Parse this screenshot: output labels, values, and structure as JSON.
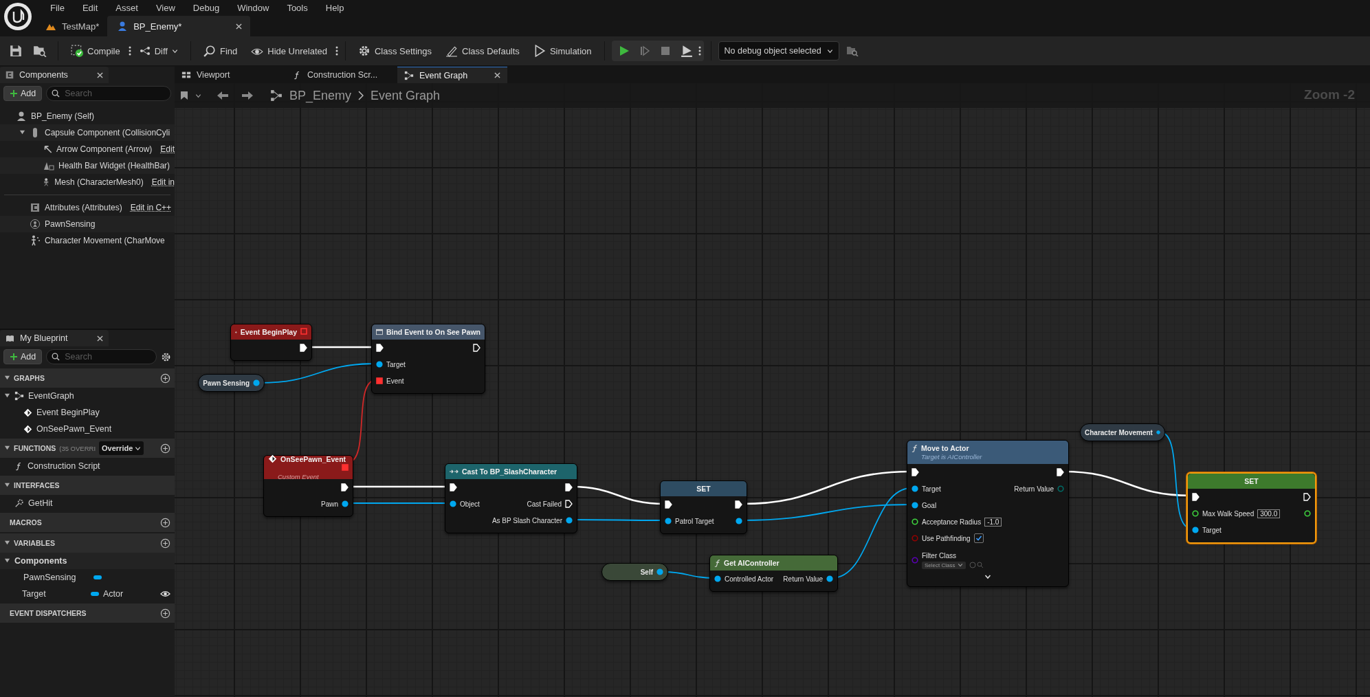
{
  "menu": [
    "File",
    "Edit",
    "Asset",
    "View",
    "Debug",
    "Window",
    "Tools",
    "Help"
  ],
  "doc_tabs": [
    {
      "label": "TestMap*",
      "kind": "map",
      "selected": false
    },
    {
      "label": "BP_Enemy*",
      "kind": "blueprint",
      "selected": true
    }
  ],
  "toolbar": [
    {
      "label": "Compile",
      "kind": "compile",
      "more": true
    },
    {
      "label": "Diff",
      "kind": "diff",
      "dropdown": true
    },
    {
      "label": "Find",
      "kind": "find"
    },
    {
      "label": "Hide Unrelated",
      "kind": "hide",
      "more": true
    },
    {
      "label": "Class Settings",
      "kind": "settings"
    },
    {
      "label": "Class Defaults",
      "kind": "defaults"
    },
    {
      "label": "Simulation",
      "kind": "simulation"
    }
  ],
  "debug_selector": {
    "value": "No debug object selected"
  },
  "components": {
    "title": "Components",
    "add_label": "Add",
    "search_placeholder": "Search",
    "tree": [
      {
        "label": "BP_Enemy (Self)",
        "kind": "self",
        "children": [
          {
            "label": "Capsule Component (CollisionCyli",
            "kind": "capsule",
            "expanded": true,
            "children": [
              {
                "label": "Arrow Component (Arrow)",
                "kind": "arrow",
                "link": "Edit"
              },
              {
                "label": "Health Bar Widget (HealthBar)",
                "kind": "widget"
              },
              {
                "label": "Mesh (CharacterMesh0)",
                "kind": "mesh",
                "link": "Edit in"
              }
            ]
          }
        ]
      }
    ],
    "other": [
      {
        "label": "Attributes (Attributes)",
        "kind": "attributes",
        "link": "Edit in C++"
      },
      {
        "label": "PawnSensing",
        "kind": "sensing"
      },
      {
        "label": "Character Movement (CharMove",
        "kind": "movement"
      }
    ]
  },
  "my_blueprint": {
    "title": "My Blueprint",
    "add_label": "Add",
    "search_placeholder": "Search",
    "sections": [
      {
        "title": "GRAPHS",
        "expanded": true,
        "addable": true,
        "items": [
          {
            "label": "EventGraph",
            "kind": "graph",
            "expanded": true,
            "children": [
              {
                "label": "Event BeginPlay",
                "kind": "event"
              },
              {
                "label": "OnSeePawn_Event",
                "kind": "event"
              }
            ]
          }
        ]
      },
      {
        "title": "FUNCTIONS",
        "note": "(35 OVERRI",
        "override_label": "Override",
        "expanded": true,
        "addable": true,
        "items": [
          {
            "label": "Construction Script",
            "kind": "function"
          }
        ]
      },
      {
        "title": "INTERFACES",
        "expanded": true,
        "addable": false,
        "items": [
          {
            "label": "GetHit",
            "kind": "interface"
          }
        ]
      },
      {
        "title": "MACROS",
        "addable": true
      },
      {
        "title": "VARIABLES",
        "expanded": true,
        "addable": true,
        "items": [
          {
            "label": "Components",
            "kind": "category",
            "expanded": true,
            "children": [
              {
                "label": "PawnSensing",
                "kind": "variable",
                "color": "#00a8f0"
              }
            ]
          },
          {
            "label": "Target",
            "kind": "variable",
            "color": "#00a8f0",
            "type": "Actor",
            "public": true
          }
        ]
      },
      {
        "title": "EVENT DISPATCHERS",
        "addable": true
      }
    ]
  },
  "graph": {
    "tabs": [
      {
        "label": "Viewport",
        "kind": "viewport",
        "selected": false
      },
      {
        "label": "Construction Scr...",
        "kind": "function",
        "selected": false
      },
      {
        "label": "Event Graph",
        "kind": "graph",
        "selected": true
      }
    ],
    "breadcrumb": [
      "BP_Enemy",
      "Event Graph"
    ],
    "zoom": "Zoom -2",
    "nodes": [
      {
        "kind": "event",
        "title": "Event BeginPlay",
        "color": "#8a1a1a",
        "selected": false,
        "rows": [
          {
            "right": {
              "kind": "exec"
            }
          }
        ]
      },
      {
        "kind": "bind",
        "title": "Bind Event to On See Pawn",
        "color": "#46566a",
        "selected": false,
        "rows": [
          {
            "left": {
              "kind": "exec"
            },
            "right": {
              "kind": "exec"
            }
          },
          {
            "left": {
              "kind": "object",
              "label": "Target"
            }
          },
          {
            "left": {
              "kind": "delegate",
              "label": "Event"
            }
          }
        ]
      },
      {
        "kind": "getter",
        "title": "Pawn Sensing",
        "color": "#2f3a44",
        "selected": false,
        "pin": {
          "kind": "object"
        }
      },
      {
        "kind": "event",
        "title": "OnSeePawn_Event",
        "subtitle": "Custom Event",
        "color": "#8a1a1a",
        "selected": false,
        "rows": [
          {
            "right": {
              "kind": "exec"
            }
          },
          {
            "right": {
              "kind": "object",
              "label": "Pawn"
            }
          }
        ]
      },
      {
        "kind": "cast",
        "title": "Cast To BP_SlashCharacter",
        "color": "#1d646b",
        "selected": false,
        "rows": [
          {
            "left": {
              "kind": "exec"
            },
            "right": {
              "kind": "exec"
            }
          },
          {
            "left": {
              "kind": "object",
              "label": "Object"
            },
            "right": {
              "kind": "exec",
              "label": "Cast Failed"
            }
          },
          {
            "right": {
              "kind": "object",
              "label": "As BP Slash Character"
            }
          }
        ]
      },
      {
        "kind": "set",
        "title": "SET",
        "color": "#2e4c62",
        "selected": false,
        "rows": [
          {
            "left": {
              "kind": "exec"
            },
            "right": {
              "kind": "exec"
            }
          },
          {
            "left": {
              "kind": "object",
              "label": "Patrol Target"
            },
            "right": {
              "kind": "object"
            }
          }
        ]
      },
      {
        "kind": "getter",
        "title": "Self",
        "color": "#3a4838",
        "selected": false,
        "pin": {
          "kind": "object"
        }
      },
      {
        "kind": "pure",
        "title": "Get AIController",
        "color": "#456a38",
        "selected": false,
        "rows": [
          {
            "left": {
              "kind": "object",
              "label": "Controlled Actor"
            },
            "right": {
              "kind": "object",
              "label": "Return Value"
            }
          }
        ]
      },
      {
        "kind": "function",
        "title": "Move to Actor",
        "subtitle": "Target is AIController",
        "color": "#3b5a78",
        "selected": false,
        "expandable": true,
        "rows": [
          {
            "left": {
              "kind": "exec"
            },
            "right": {
              "kind": "exec"
            }
          },
          {
            "left": {
              "kind": "object",
              "label": "Target"
            },
            "right": {
              "kind": "enum",
              "label": "Return Value"
            }
          },
          {
            "left": {
              "kind": "object",
              "label": "Goal"
            }
          },
          {
            "left": {
              "kind": "float",
              "label": "Acceptance Radius",
              "value": "-1.0"
            }
          },
          {
            "left": {
              "kind": "bool",
              "label": "Use Pathfinding",
              "checked": true
            }
          },
          {
            "left": {
              "kind": "class",
              "label": "Filter Class",
              "value": "Select Class"
            }
          }
        ]
      },
      {
        "kind": "getter",
        "title": "Character Movement",
        "color": "#2f3a44",
        "selected": false,
        "pin": {
          "kind": "object"
        }
      },
      {
        "kind": "set",
        "title": "SET",
        "color": "#3d7a2c",
        "selected": true,
        "rows": [
          {
            "left": {
              "kind": "exec"
            },
            "right": {
              "kind": "exec"
            }
          },
          {
            "left": {
              "kind": "float",
              "label": "Max Walk Speed",
              "value": "300.0"
            },
            "right": {
              "kind": "float"
            }
          },
          {
            "left": {
              "kind": "object",
              "label": "Target"
            }
          }
        ]
      }
    ]
  }
}
